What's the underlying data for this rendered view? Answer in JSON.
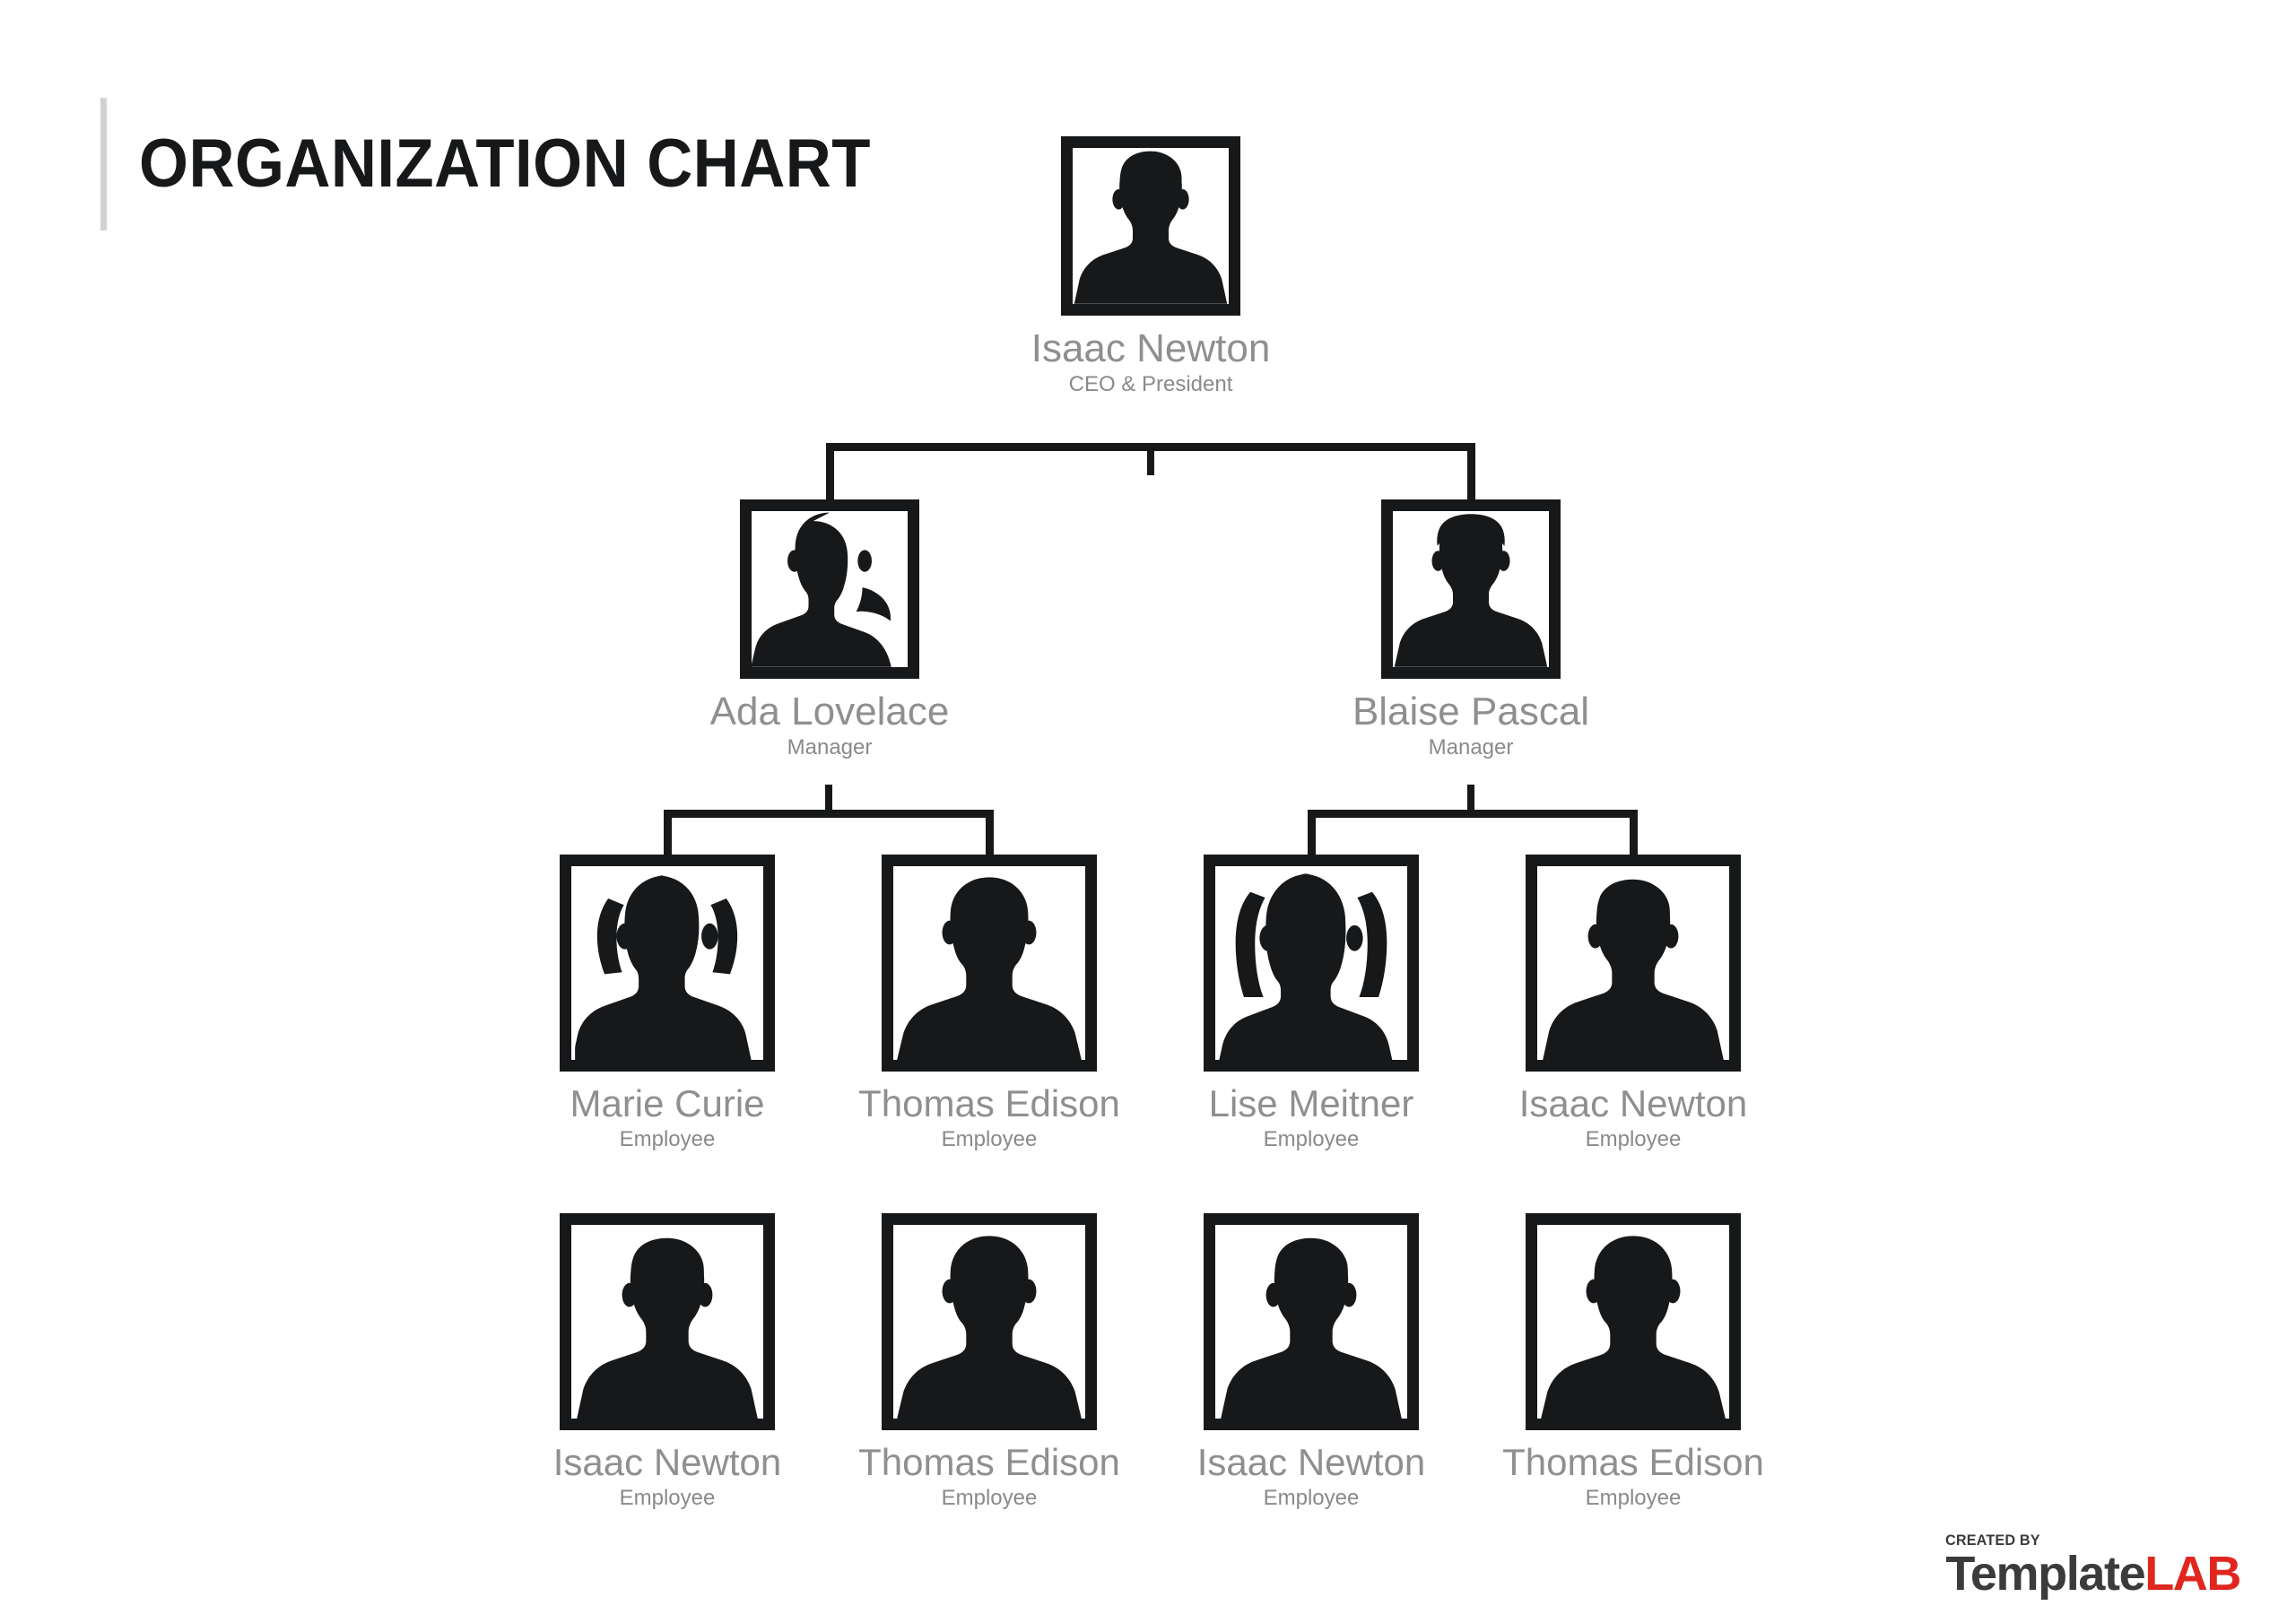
{
  "header": {
    "title": "ORGANIZATION CHART",
    "accent_bar_color": "#d2d2d2"
  },
  "colors": {
    "background": "#ffffff",
    "frame": "#17181a",
    "connector": "#17181a",
    "name_text": "#8f8f8f",
    "role_text": "#8a8a8a",
    "title_text": "#17181a",
    "logo_dark": "#3b3b3b",
    "logo_red": "#e0271f"
  },
  "chart_data": {
    "type": "diagram",
    "title": "ORGANIZATION CHART",
    "levels": [
      "CEO & President",
      "Manager",
      "Employee"
    ],
    "nodes": [
      {
        "id": "ceo",
        "name": "Isaac Newton",
        "role": "CEO & President",
        "level": 0,
        "avatar": "man-curly-hair-silhouette",
        "parent": null
      },
      {
        "id": "mgr1",
        "name": "Ada Lovelace",
        "role": "Manager",
        "level": 1,
        "avatar": "woman-ponytail-silhouette",
        "parent": "ceo"
      },
      {
        "id": "mgr2",
        "name": "Blaise Pascal",
        "role": "Manager",
        "level": 1,
        "avatar": "man-short-hair-silhouette",
        "parent": "ceo"
      },
      {
        "id": "emp1",
        "name": "Marie Curie",
        "role": "Employee",
        "level": 2,
        "avatar": "woman-bob-hair-silhouette",
        "parent": "mgr1"
      },
      {
        "id": "emp2",
        "name": "Thomas Edison",
        "role": "Employee",
        "level": 2,
        "avatar": "man-bald-silhouette",
        "parent": "mgr1"
      },
      {
        "id": "emp3",
        "name": "Lise Meitner",
        "role": "Employee",
        "level": 2,
        "avatar": "woman-long-hair-silhouette",
        "parent": "mgr2"
      },
      {
        "id": "emp4",
        "name": "Isaac Newton",
        "role": "Employee",
        "level": 2,
        "avatar": "man-curly-hair-silhouette",
        "parent": "mgr2"
      },
      {
        "id": "emp5",
        "name": "Isaac Newton",
        "role": "Employee",
        "level": 3,
        "avatar": "man-curly-hair-silhouette",
        "parent": null
      },
      {
        "id": "emp6",
        "name": "Thomas Edison",
        "role": "Employee",
        "level": 3,
        "avatar": "man-bald-silhouette",
        "parent": null
      },
      {
        "id": "emp7",
        "name": "Isaac Newton",
        "role": "Employee",
        "level": 3,
        "avatar": "man-curly-hair-silhouette",
        "parent": null
      },
      {
        "id": "emp8",
        "name": "Thomas Edison",
        "role": "Employee",
        "level": 3,
        "avatar": "man-bald-silhouette",
        "parent": null
      }
    ]
  },
  "nodes": {
    "ceo": {
      "name": "Isaac Newton",
      "role": "CEO & President"
    },
    "mgr1": {
      "name": "Ada Lovelace",
      "role": "Manager"
    },
    "mgr2": {
      "name": "Blaise Pascal",
      "role": "Manager"
    },
    "emp1": {
      "name": "Marie Curie",
      "role": "Employee"
    },
    "emp2": {
      "name": "Thomas Edison",
      "role": "Employee"
    },
    "emp3": {
      "name": "Lise Meitner",
      "role": "Employee"
    },
    "emp4": {
      "name": "Isaac Newton",
      "role": "Employee"
    },
    "emp5": {
      "name": "Isaac Newton",
      "role": "Employee"
    },
    "emp6": {
      "name": "Thomas Edison",
      "role": "Employee"
    },
    "emp7": {
      "name": "Isaac Newton",
      "role": "Employee"
    },
    "emp8": {
      "name": "Thomas Edison",
      "role": "Employee"
    }
  },
  "footer": {
    "created_by": "CREATED BY",
    "brand_first": "Template",
    "brand_second": "LAB"
  }
}
